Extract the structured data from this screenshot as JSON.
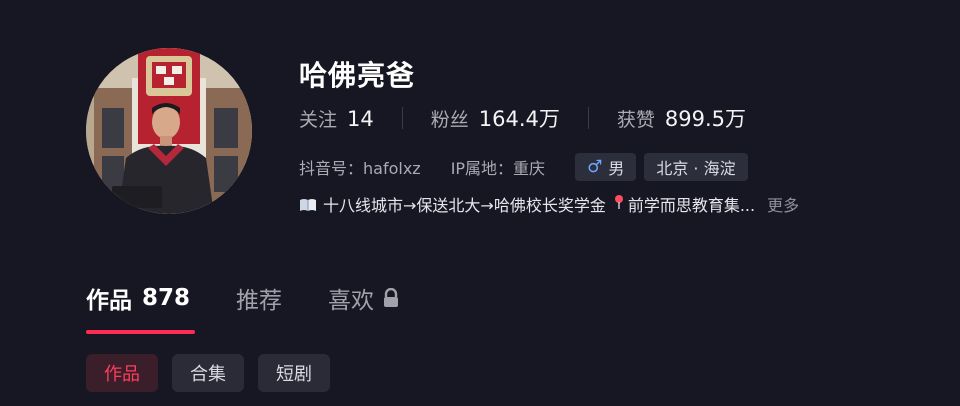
{
  "profile": {
    "nickname": "哈佛亮爸",
    "stats": [
      {
        "label": "关注",
        "value": "14"
      },
      {
        "label": "粉丝",
        "value": "164.4万"
      },
      {
        "label": "获赞",
        "value": "899.5万"
      }
    ],
    "douyin_id": "抖音号：hafolxz",
    "ip_location": "IP属地：重庆",
    "gender_symbol": "♂",
    "gender": "男",
    "region": "北京 · 海淀",
    "bio_part1": "十八线城市→保送北大→哈佛校长奖学金",
    "bio_part2": "前学而思教育集...",
    "more": "更多"
  },
  "tabs": [
    {
      "label": "作品",
      "count": "878"
    },
    {
      "label": "推荐"
    },
    {
      "label": "喜欢"
    }
  ],
  "filters": [
    "作品",
    "合集",
    "短剧"
  ],
  "colors": {
    "background": "#161722",
    "accent": "#fe2c55",
    "chip_active_text": "#ff3d5e"
  },
  "icons": [
    "book-icon",
    "location-pin-icon",
    "lock-icon",
    "male-icon"
  ]
}
